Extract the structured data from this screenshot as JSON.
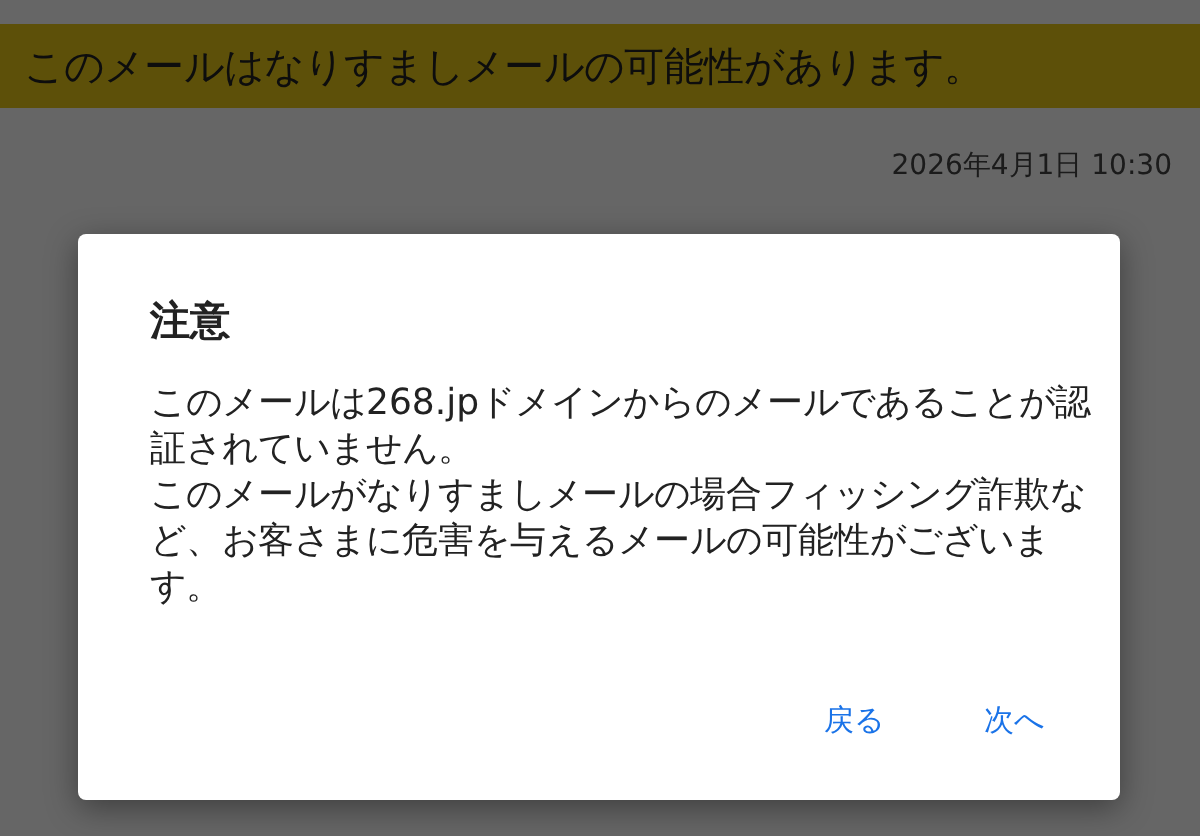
{
  "warning_banner": "このメールはなりすましメールの可能性があります。",
  "date": "2026年4月1日 10:30",
  "dialog": {
    "title": "注意",
    "message": [
      "このメールは268.jpドメインからのメールであることが認証されていません。",
      "このメールがなりすましメールの場合フィッシング詐欺など、お客さまに危害を与えるメールの可能性がございます。"
    ],
    "buttons": [
      "戻る",
      "次へ"
    ]
  }
}
